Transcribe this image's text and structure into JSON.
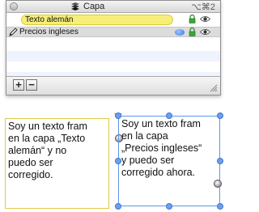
{
  "palette": {
    "title": "Capa",
    "shortcut": "⌥⌘2",
    "layers": [
      {
        "name": "Texto alemán",
        "state": "inactive",
        "locked": true,
        "visible": true
      },
      {
        "name": "Precios ingleses",
        "state": "active",
        "locked": true,
        "visible": true
      }
    ],
    "footer": {
      "add_label": "+",
      "remove_label": "−"
    }
  },
  "frames": {
    "left_text": "Soy un texto fram\nen la capa „Texto\nalemán“ y no\npuedo ser\ncorregido.",
    "right_text": "Soy un texto fram\nen la capa\n„Precios ingleses“\ny puedo ser\ncorregido ahora."
  },
  "colors": {
    "layer_highlight": "#f6ee79",
    "selection_blue": "#5f96e8",
    "left_frame_border": "#e2c848"
  }
}
